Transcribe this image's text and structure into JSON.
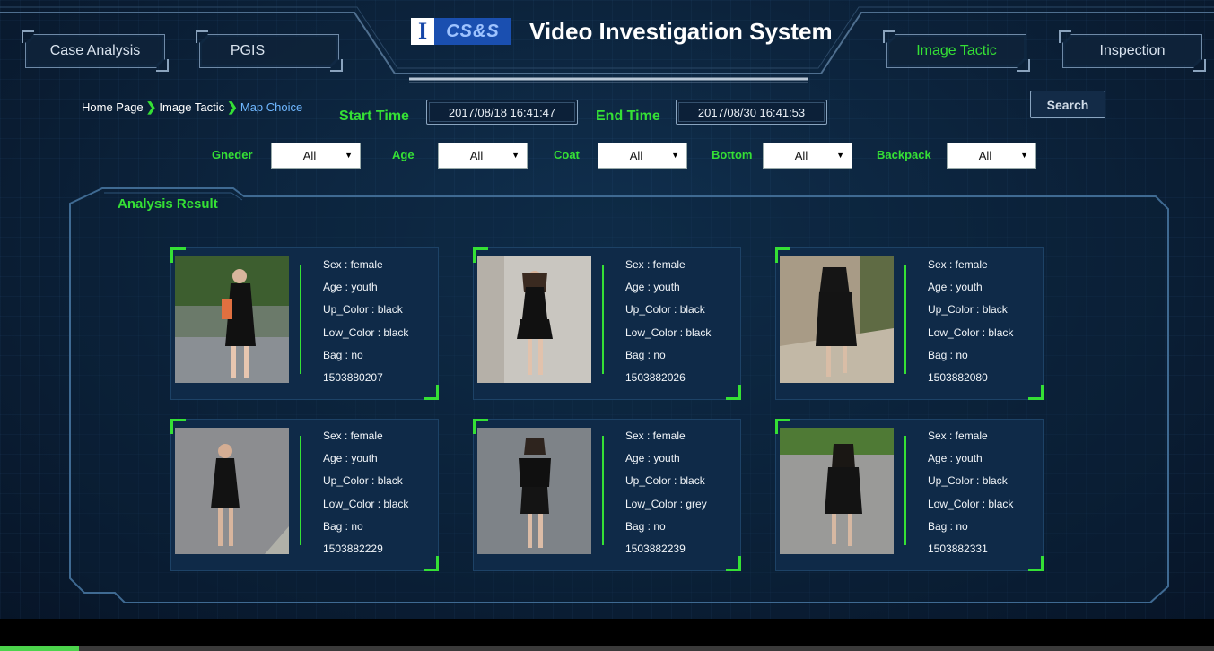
{
  "nav": {
    "case_analysis": "Case Analysis",
    "pgis": "PGIS",
    "image_tactic": "Image Tactic",
    "inspection": "Inspection"
  },
  "logo": {
    "mark": "I",
    "text": "CS&S"
  },
  "app_title": "Video Investigation System",
  "breadcrumb": {
    "items": [
      "Home Page",
      "Image Tactic",
      "Map Choice"
    ]
  },
  "time": {
    "start_label": "Start Time",
    "start_value": "2017/08/18 16:41:47",
    "end_label": "End Time",
    "end_value": "2017/08/30 16:41:53"
  },
  "search_label": "Search",
  "filters": [
    {
      "label": "Gneder",
      "value": "All"
    },
    {
      "label": "Age",
      "value": "All"
    },
    {
      "label": "Coat",
      "value": "All"
    },
    {
      "label": "Bottom",
      "value": "All"
    },
    {
      "label": "Backpack",
      "value": "All"
    }
  ],
  "result_title": "Analysis Result",
  "results": [
    {
      "sex": "Sex : female",
      "age": "Age : youth",
      "up": "Up_Color : black",
      "low": "Low_Color : black",
      "bag": "Bag : no",
      "id": "1503880207"
    },
    {
      "sex": "Sex : female",
      "age": "Age : youth",
      "up": "Up_Color : black",
      "low": "Low_Color : black",
      "bag": "Bag : no",
      "id": "1503882026"
    },
    {
      "sex": "Sex : female",
      "age": "Age : youth",
      "up": "Up_Color : black",
      "low": "Low_Color : black",
      "bag": "Bag : no",
      "id": "1503882080"
    },
    {
      "sex": "Sex : female",
      "age": "Age : youth",
      "up": "Up_Color : black",
      "low": "Low_Color : black",
      "bag": "Bag : no",
      "id": "1503882229"
    },
    {
      "sex": "Sex : female",
      "age": "Age : youth",
      "up": "Up_Color : black",
      "low": "Low_Color : grey",
      "bag": "Bag : no",
      "id": "1503882239"
    },
    {
      "sex": "Sex : female",
      "age": "Age : youth",
      "up": "Up_Color : black",
      "low": "Low_Color : black",
      "bag": "Bag : no",
      "id": "1503882331"
    }
  ],
  "colors": {
    "accent_green": "#35e035",
    "background": "#0b2038",
    "card": "#0f2a48"
  },
  "progress": {
    "fraction": 0.065
  }
}
